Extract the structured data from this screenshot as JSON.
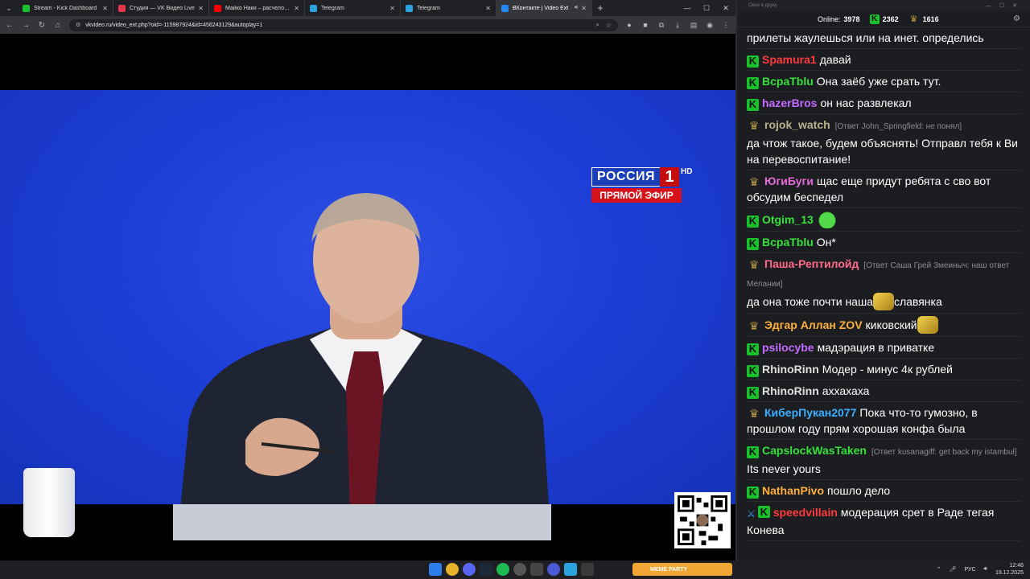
{
  "browser": {
    "tabs": [
      {
        "label": "Stream - Kick Dashboard",
        "color": "#18c12a",
        "active": false
      },
      {
        "label": "Студия — VK Видео Live",
        "color": "#e8334a",
        "active": false
      },
      {
        "label": "Майко Наки – расчеловечива…",
        "color": "#ff0000",
        "active": false
      },
      {
        "label": "Telegram",
        "color": "#2aa3df",
        "active": false
      },
      {
        "label": "Telegram",
        "color": "#2aa3df",
        "active": false
      },
      {
        "label": "ВКонтакте | Video Ext",
        "color": "#2787f5",
        "active": true
      }
    ],
    "url": "vkvideo.ru/video_ext.php?oid=-115987924&id=456243129&autoplay=1"
  },
  "video": {
    "channel_logo": "РОССИЯ",
    "channel_number": "1",
    "channel_hd": "HD",
    "live_label": "ПРЯМОЙ ЭФИР"
  },
  "chat": {
    "window_title": "Окно в друку",
    "online_label": "Online:",
    "online_count": "3978",
    "kick_count": "2362",
    "twitch_count": "1616",
    "messages": [
      {
        "platform": "",
        "user": "",
        "color": "#ffffff",
        "reply": "",
        "text": "прилеты жаулешься или на инет. определись"
      },
      {
        "platform": "kick",
        "user": "Spamura1",
        "color": "#ff3b3b",
        "reply": "",
        "text": "давай"
      },
      {
        "platform": "kick",
        "user": "BcpaTblu",
        "color": "#37e03a",
        "reply": "",
        "text": "Она заёб уже срать тут."
      },
      {
        "platform": "kick",
        "user": "hazerBros",
        "color": "#c46bff",
        "reply": "",
        "text": "он нас развлекал"
      },
      {
        "platform": "twitch",
        "user": "rojok_watch",
        "color": "#b9b28c",
        "reply": "[Ответ John_Springfield: не понял]",
        "text": "да чтож такое, будем объяснять! Отправл тебя к Ви на перевоспитание!"
      },
      {
        "platform": "twitch",
        "user": "ЮгиБуги",
        "color": "#e46bd8",
        "reply": "",
        "text": "щас еще придут ребята с сво вот обсудим беспедел"
      },
      {
        "platform": "kick",
        "user": "Otgim_13",
        "color": "#37e03a",
        "reply": "",
        "text": "",
        "emote": "green"
      },
      {
        "platform": "kick",
        "user": "BcpaTblu",
        "color": "#37e03a",
        "reply": "",
        "text": "Он*"
      },
      {
        "platform": "twitch",
        "user": "Паша-Рептилойд",
        "color": "#ff6b8a",
        "reply": "[Ответ Саша Грей Змеиныч: наш ответ Мелании]",
        "text": "да она тоже почти наша",
        "emote_mid": "gold",
        "text_after": "славянка"
      },
      {
        "platform": "twitch",
        "user": "Эдгар Аллан ZOV",
        "color": "#ffb13b",
        "reply": "",
        "text": "киковский",
        "emote": "gold"
      },
      {
        "platform": "kick",
        "user": "psilocybe",
        "color": "#c46bff",
        "reply": "",
        "text": "мадэрация в приватке"
      },
      {
        "platform": "kick",
        "user": "RhinoRinn",
        "color": "#e0e0e0",
        "reply": "",
        "text": "Модер - минус 4к рублей"
      },
      {
        "platform": "kick",
        "user": "RhinoRinn",
        "color": "#e0e0e0",
        "reply": "",
        "text": "аххахаха"
      },
      {
        "platform": "twitch",
        "user": "КиберПукан2077",
        "color": "#3ab0ff",
        "reply": "",
        "text": "Пока что-то гумозно, в прошлом году прям хорошая конфа была"
      },
      {
        "platform": "kick",
        "user": "CapslockWasTaken",
        "color": "#37e03a",
        "reply": "[Ответ kusanagiff: get back my istambul]",
        "text": "Its never yours"
      },
      {
        "platform": "kick",
        "user": "NathanPivo",
        "color": "#ffb13b",
        "reply": "",
        "text": "пошло дело"
      },
      {
        "platform": "kick-sword",
        "user": "speedvillain",
        "color": "#ff3b3b",
        "reply": "",
        "text": "модерация срет в Раде тегая Конева"
      }
    ]
  },
  "taskbar": {
    "widget_label": "MEME PARTY",
    "lang": "РУС",
    "time": "12:46",
    "date": "19.12.2025"
  }
}
